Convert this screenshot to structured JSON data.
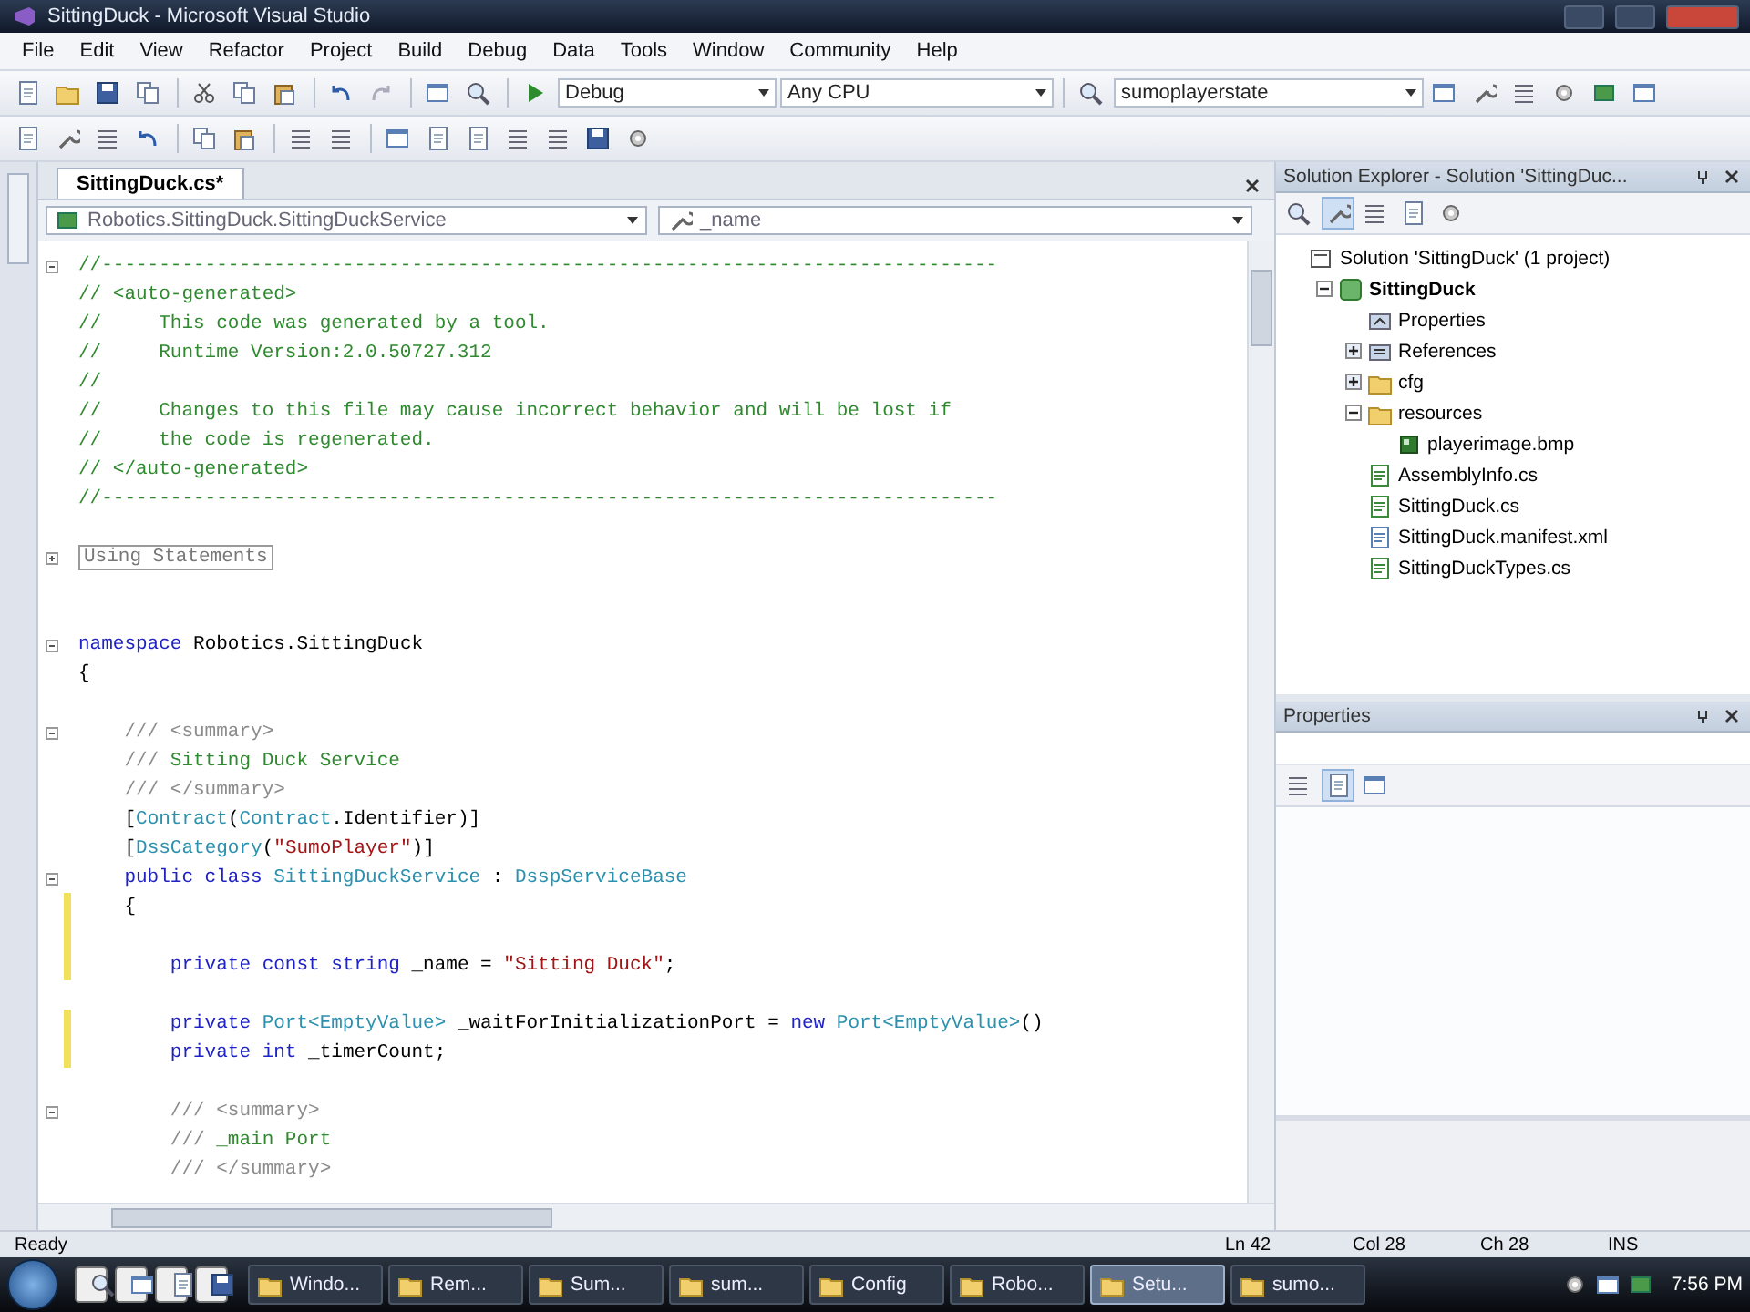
{
  "window": {
    "title": "SittingDuck - Microsoft Visual Studio"
  },
  "menu": [
    "File",
    "Edit",
    "View",
    "Refactor",
    "Project",
    "Build",
    "Debug",
    "Data",
    "Tools",
    "Window",
    "Community",
    "Help"
  ],
  "toolbar": {
    "configuration": "Debug",
    "platform": "Any CPU",
    "find": "sumoplayerstate"
  },
  "document_tab": {
    "label": "SittingDuck.cs*",
    "selected": true
  },
  "navigation": {
    "type": "Robotics.SittingDuck.SittingDuckService",
    "member": "_name"
  },
  "code_lines": [
    {
      "collapsed": false,
      "segments": [
        {
          "kind": "comment",
          "text": "//------------------------------------------------------------------------------"
        }
      ]
    },
    {
      "segments": [
        {
          "kind": "comment",
          "text": "// <auto-generated>"
        }
      ]
    },
    {
      "segments": [
        {
          "kind": "comment",
          "text": "//     This code was generated by a tool."
        }
      ]
    },
    {
      "segments": [
        {
          "kind": "comment",
          "text": "//     Runtime Version:2.0.50727.312"
        }
      ]
    },
    {
      "segments": [
        {
          "kind": "comment",
          "text": "//"
        }
      ]
    },
    {
      "segments": [
        {
          "kind": "comment",
          "text": "//     Changes to this file may cause incorrect behavior and will be lost if"
        }
      ]
    },
    {
      "segments": [
        {
          "kind": "comment",
          "text": "//     the code is regenerated."
        }
      ]
    },
    {
      "segments": [
        {
          "kind": "comment",
          "text": "// </auto-generated>"
        }
      ]
    },
    {
      "segments": [
        {
          "kind": "comment",
          "text": "//------------------------------------------------------------------------------"
        }
      ]
    },
    {
      "kind": "blank"
    },
    {
      "collapsed": true,
      "segments": [
        {
          "kind": "region",
          "text": "Using Statements"
        }
      ]
    },
    {
      "kind": "blank"
    },
    {
      "kind": "blank"
    },
    {
      "collapsed": false,
      "segments": [
        {
          "kind": "keyword",
          "text": "namespace"
        },
        {
          "kind": "plain",
          "text": " Robotics.SittingDuck"
        }
      ]
    },
    {
      "segments": [
        {
          "kind": "plain",
          "text": "{"
        }
      ]
    },
    {
      "kind": "blank"
    },
    {
      "collapsed": false,
      "segments": [
        {
          "kind": "doc",
          "text": "    /// <summary>"
        }
      ]
    },
    {
      "segments": [
        {
          "kind": "doc",
          "text": "    /// "
        },
        {
          "kind": "comment",
          "text": "Sitting Duck Service"
        }
      ]
    },
    {
      "segments": [
        {
          "kind": "doc",
          "text": "    /// </summary>"
        }
      ]
    },
    {
      "segments": [
        {
          "kind": "plain",
          "text": "    ["
        },
        {
          "kind": "type",
          "text": "Contract"
        },
        {
          "kind": "plain",
          "text": "("
        },
        {
          "kind": "type",
          "text": "Contract"
        },
        {
          "kind": "plain",
          "text": ".Identifier)]"
        }
      ]
    },
    {
      "segments": [
        {
          "kind": "plain",
          "text": "    ["
        },
        {
          "kind": "type",
          "text": "DssCategory"
        },
        {
          "kind": "plain",
          "text": "("
        },
        {
          "kind": "string",
          "text": "\"SumoPlayer\""
        },
        {
          "kind": "plain",
          "text": ")]"
        }
      ]
    },
    {
      "collapsed": false,
      "segments": [
        {
          "kind": "keyword",
          "text": "    public class "
        },
        {
          "kind": "type",
          "text": "SittingDuckService"
        },
        {
          "kind": "plain",
          "text": " : "
        },
        {
          "kind": "type",
          "text": "DsspServiceBase"
        }
      ]
    },
    {
      "changed": true,
      "segments": [
        {
          "kind": "plain",
          "text": "    {"
        }
      ]
    },
    {
      "kind": "blank",
      "changed": true
    },
    {
      "changed": true,
      "segments": [
        {
          "kind": "keyword",
          "text": "        private const string"
        },
        {
          "kind": "plain",
          "text": " _name = "
        },
        {
          "kind": "string",
          "text": "\"Sitting Duck\""
        },
        {
          "kind": "plain",
          "text": ";"
        }
      ]
    },
    {
      "kind": "blank"
    },
    {
      "changed": true,
      "segments": [
        {
          "kind": "keyword",
          "text": "        private "
        },
        {
          "kind": "type",
          "text": "Port<EmptyValue>"
        },
        {
          "kind": "plain",
          "text": " _waitForInitializationPort = "
        },
        {
          "kind": "keyword",
          "text": "new "
        },
        {
          "kind": "type",
          "text": "Port<EmptyValue>"
        },
        {
          "kind": "plain",
          "text": "()"
        }
      ]
    },
    {
      "changed": true,
      "segments": [
        {
          "kind": "keyword",
          "text": "        private int"
        },
        {
          "kind": "plain",
          "text": " _timerCount;"
        }
      ]
    },
    {
      "kind": "blank"
    },
    {
      "collapsed": false,
      "segments": [
        {
          "kind": "doc",
          "text": "        /// <summary>"
        }
      ]
    },
    {
      "segments": [
        {
          "kind": "doc",
          "text": "        /// "
        },
        {
          "kind": "comment",
          "text": "_main Port"
        }
      ]
    },
    {
      "segments": [
        {
          "kind": "doc",
          "text": "        /// </summary>"
        }
      ]
    }
  ],
  "solution_explorer": {
    "title": "Solution Explorer - Solution 'SittingDuc...",
    "tree": [
      {
        "label": "Solution 'SittingDuck' (1 project)",
        "kind": "solution",
        "children": [
          {
            "label": "SittingDuck",
            "kind": "project",
            "expanded": true,
            "children": [
              {
                "label": "Properties",
                "kind": "properties"
              },
              {
                "label": "References",
                "kind": "references",
                "expanded": false
              },
              {
                "label": "cfg",
                "kind": "folder",
                "expanded": false
              },
              {
                "label": "resources",
                "kind": "folder",
                "expanded": true,
                "children": [
                  {
                    "label": "playerimage.bmp",
                    "kind": "image"
                  }
                ]
              },
              {
                "label": "AssemblyInfo.cs",
                "kind": "code"
              },
              {
                "label": "SittingDuck.cs",
                "kind": "code"
              },
              {
                "label": "SittingDuck.manifest.xml",
                "kind": "xml"
              },
              {
                "label": "SittingDuckTypes.cs",
                "kind": "code"
              }
            ]
          }
        ]
      }
    ]
  },
  "properties": {
    "title": "Properties"
  },
  "status_bar": {
    "message": "Ready",
    "line": "Ln 42",
    "column": "Col 28",
    "char": "Ch 28",
    "mode": "INS"
  },
  "taskbar": {
    "items": [
      {
        "label": "Windo...",
        "selected": false
      },
      {
        "label": "Rem...",
        "selected": false
      },
      {
        "label": "Sum...",
        "selected": false
      },
      {
        "label": "sum...",
        "selected": false
      },
      {
        "label": "Config",
        "selected": false
      },
      {
        "label": "Robo...",
        "selected": false
      },
      {
        "label": "Setu...",
        "selected": true
      },
      {
        "label": "sumo...",
        "selected": false
      }
    ],
    "clock": "7:56 PM"
  }
}
